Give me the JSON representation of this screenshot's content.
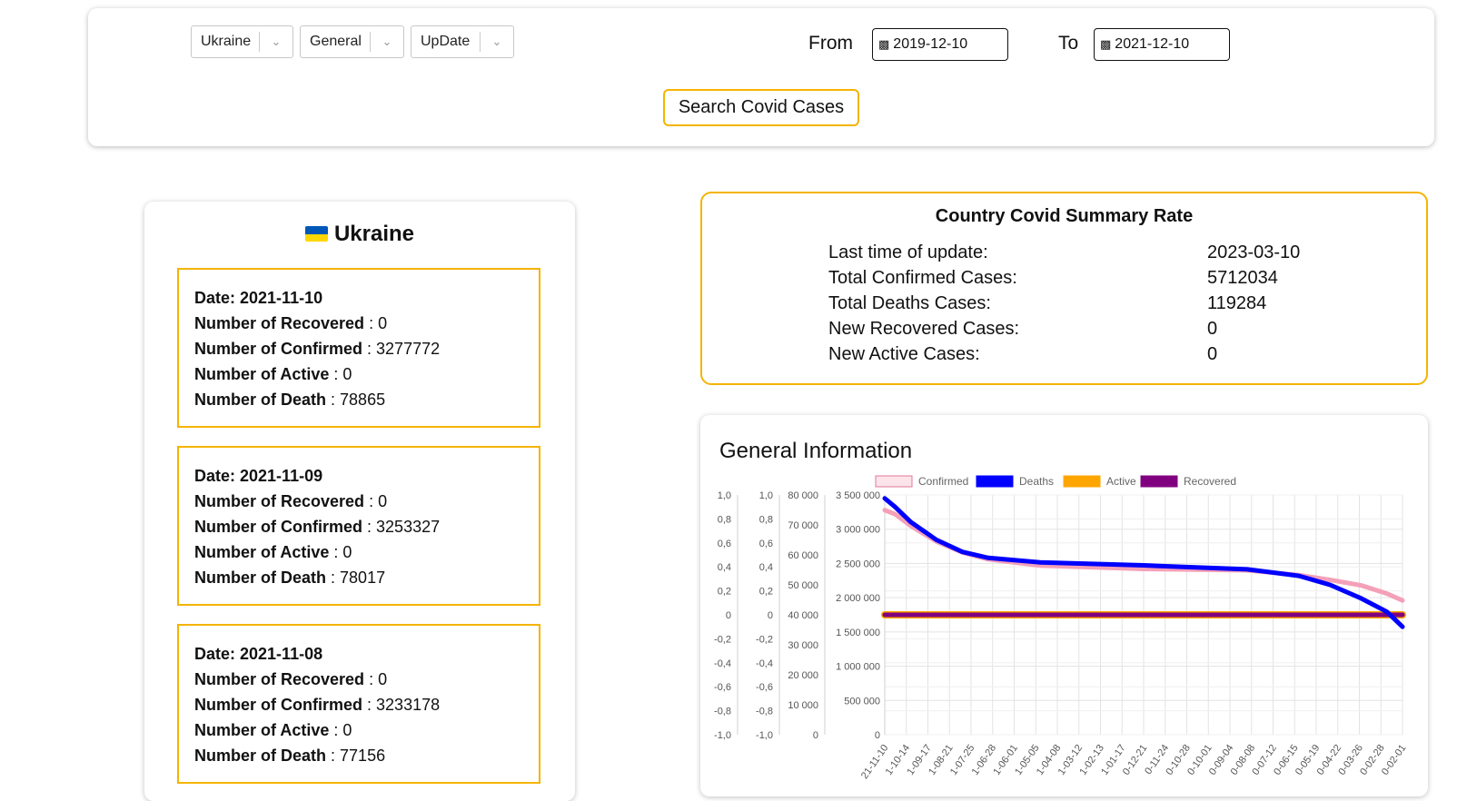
{
  "filters": {
    "country": "Ukraine",
    "type": "General",
    "sort": "UpDate",
    "from_label": "From",
    "to_label": "To",
    "from_date": "2019-12-10",
    "to_date": "2021-12-10",
    "search_label": "Search Covid Cases"
  },
  "country_panel": {
    "name": "Ukraine",
    "labels": {
      "recovered": "Number of Recovered",
      "confirmed": "Number of Confirmed",
      "active": "Number of Active",
      "death": "Number of Death"
    },
    "records": [
      {
        "date": "Date: 2021-11-10",
        "recovered": ": 0",
        "confirmed": ": 3277772",
        "active": ": 0",
        "death": ": 78865"
      },
      {
        "date": "Date: 2021-11-09",
        "recovered": ": 0",
        "confirmed": ": 3253327",
        "active": ": 0",
        "death": ": 78017"
      },
      {
        "date": "Date: 2021-11-08",
        "recovered": ": 0",
        "confirmed": ": 3233178",
        "active": ": 0",
        "death": ": 77156"
      }
    ]
  },
  "summary": {
    "title": "Country Covid Summary Rate",
    "rows": [
      {
        "label": "Last time of update:",
        "value": "2023-03-10"
      },
      {
        "label": "Total Confirmed Cases:",
        "value": "5712034"
      },
      {
        "label": "Total Deaths Cases:",
        "value": "119284"
      },
      {
        "label": "New Recovered Cases:",
        "value": "0"
      },
      {
        "label": "New Active Cases:",
        "value": "0"
      }
    ]
  },
  "chart_data": {
    "type": "line",
    "title": "General Information",
    "legend": [
      "Confirmed",
      "Deaths",
      "Active",
      "Recovered"
    ],
    "legend_position": "top",
    "colors": {
      "Confirmed": "#f4a0b8",
      "Deaths": "#0000ff",
      "Active": "#ffa500",
      "Recovered": "#800080"
    },
    "grid": true,
    "x_tick_labels": [
      "21-11-10",
      "1-10-14",
      "1-09-17",
      "1-08-21",
      "1-07-25",
      "1-06-28",
      "1-06-01",
      "1-05-05",
      "1-04-08",
      "1-03-12",
      "1-02-13",
      "1-01-17",
      "0-12-21",
      "0-11-24",
      "0-10-28",
      "0-10-01",
      "0-09-04",
      "0-08-08",
      "0-07-12",
      "0-06-15",
      "0-05-19",
      "0-04-22",
      "0-03-26",
      "0-02-28",
      "0-02-01"
    ],
    "axes": [
      {
        "ticks": [
          "1,0",
          "0,8",
          "0,6",
          "0,4",
          "0,2",
          "0",
          "-0,2",
          "-0,4",
          "-0,6",
          "-0,8",
          "-1,0"
        ],
        "ylim": [
          -1,
          1
        ]
      },
      {
        "ticks": [
          "1,0",
          "0,8",
          "0,6",
          "0,4",
          "0,2",
          "0",
          "-0,2",
          "-0,4",
          "-0,6",
          "-0,8",
          "-1,0"
        ],
        "ylim": [
          -1,
          1
        ]
      },
      {
        "ticks": [
          "80 000",
          "70 000",
          "60 000",
          "50 000",
          "40 000",
          "30 000",
          "20 000",
          "10 000",
          "0"
        ],
        "ylim": [
          0,
          80000
        ]
      },
      {
        "ticks": [
          "3 500 000",
          "3 000 000",
          "2 500 000",
          "2 000 000",
          "1 500 000",
          "1 000 000",
          "500 000",
          "0"
        ],
        "ylim": [
          0,
          3500000
        ]
      }
    ],
    "series": [
      {
        "name": "Confirmed",
        "axis": 3,
        "x": [
          0,
          0.02,
          0.05,
          0.1,
          0.15,
          0.2,
          0.3,
          0.5,
          0.7,
          0.8,
          0.86,
          0.92,
          0.97,
          1.0
        ],
        "values": [
          3277772,
          3220000,
          3050000,
          2820000,
          2660000,
          2560000,
          2470000,
          2420000,
          2400000,
          2330000,
          2260000,
          2180000,
          2060000,
          1960000
        ]
      },
      {
        "name": "Deaths",
        "axis": 2,
        "x": [
          0,
          0.02,
          0.05,
          0.1,
          0.15,
          0.2,
          0.3,
          0.5,
          0.7,
          0.8,
          0.86,
          0.92,
          0.97,
          1.0
        ],
        "values": [
          78865,
          76000,
          71000,
          65000,
          61000,
          59000,
          57500,
          56500,
          55200,
          53000,
          50000,
          45500,
          41000,
          36000
        ]
      },
      {
        "name": "Active",
        "axis": 0,
        "x": [
          0,
          1.0
        ],
        "values": [
          0,
          0
        ]
      },
      {
        "name": "Recovered",
        "axis": 0,
        "x": [
          0,
          1.0
        ],
        "values": [
          0,
          0
        ]
      }
    ]
  }
}
